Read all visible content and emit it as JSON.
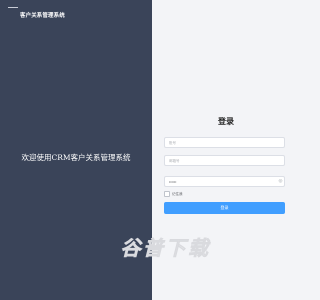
{
  "brand": {
    "title": "客户关系管理系统"
  },
  "welcome": {
    "text": "欢迎使用CRM客户关系管理系统"
  },
  "login": {
    "title": "登录",
    "username_placeholder": "账号",
    "phone_placeholder": "邮箱号",
    "password_value": "••••••",
    "remember_label": "记住我",
    "submit_label": "登录"
  },
  "icons": {
    "password_toggle": "eye-icon"
  },
  "watermark": {
    "chars": [
      "谷",
      "普",
      "下",
      "载"
    ]
  },
  "colors": {
    "sidebar_bg": "#3a4459",
    "page_bg": "#f3f4f7",
    "primary": "#409eff"
  }
}
